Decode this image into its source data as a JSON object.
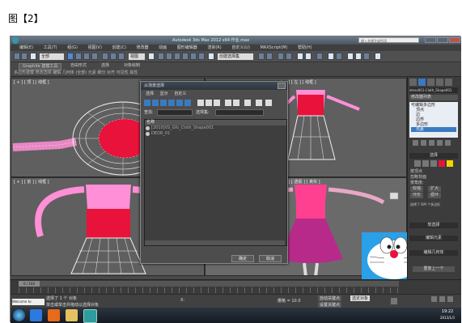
{
  "caption": "图【2】",
  "window": {
    "title": "Autodesk 3ds Max 2012 x64   作业.max",
    "search_placeholder": "键入关键字或短语"
  },
  "menu": [
    "编辑(E)",
    "工具(T)",
    "组(G)",
    "视图(V)",
    "创建(C)",
    "修改器",
    "动画",
    "图形编辑器",
    "渲染(R)",
    "自定义(U)",
    "MAXScript(M)",
    "帮助(H)"
  ],
  "toolbar": {
    "selection_filter": "全部",
    "view_dropdown": "视图",
    "named_sets": "创建选择集"
  },
  "ribbon": {
    "tabs": [
      "Graphite 建模工具",
      "自由形式",
      "选择",
      "对象绘制"
    ],
    "row": "多边形建模  修改选择  编辑  几何体 (全部)  元素  细分  对齐  可见性  属性"
  },
  "viewports": {
    "top": "[ + ] [ 顶 ] [ 线框 ]",
    "front": "[ + ] [ 前 ] [ 线框 ]",
    "left": "[ + ] [ 左 ] [ 线框 ]",
    "persp": "[ + ] [ 透视 ] [ 真实 ]"
  },
  "dialog": {
    "title": "从场景选择",
    "menu": [
      "选择",
      "显示",
      "自定义"
    ],
    "find_label": "查找:",
    "set_label": "选择集:",
    "list_header": "名称",
    "items": [
      "[2010]VS_Gfs_Cloth_Shape001",
      "DEOR_01"
    ],
    "ok": "确定",
    "cancel": "取消"
  },
  "command_panel": {
    "object_name": "dress001-Cloth_Shape001",
    "modifier_list": "修改器列表",
    "stack": [
      "可编辑多边形",
      "顶点",
      "边",
      "边界",
      "多边形",
      "元素"
    ],
    "selection_header": "选择",
    "options": [
      "按顶点",
      "忽略背面",
      "按角度:",
      "收缩",
      "扩大",
      "环形",
      "循环"
    ],
    "selected": "选择了 DM 个多边形",
    "soft_selection": "软选择",
    "edit_elements": "编辑元素",
    "edit_geometry": "编辑几何体",
    "repeat_last": "重复上一个"
  },
  "timeline": {
    "frame": "0 / 100"
  },
  "status": {
    "line1": "选择了 1 个 对象",
    "line2": "单击或单击并拖动以选择对象",
    "script": "Welcome to MAXScript",
    "coord_label": "X:",
    "grid": "栅格 = 10.0",
    "autokey": "自动关键点",
    "setkey": "设置关键点",
    "filter": "选定对象"
  },
  "taskbar": {
    "time": "19:22",
    "date": "2013/1/3"
  },
  "colors": {
    "wire": "#ff8fd6",
    "red": "#e8123a",
    "pink": "#ff3f8f",
    "white": "#f2f2f2",
    "viewport": "#5f5f5f"
  }
}
